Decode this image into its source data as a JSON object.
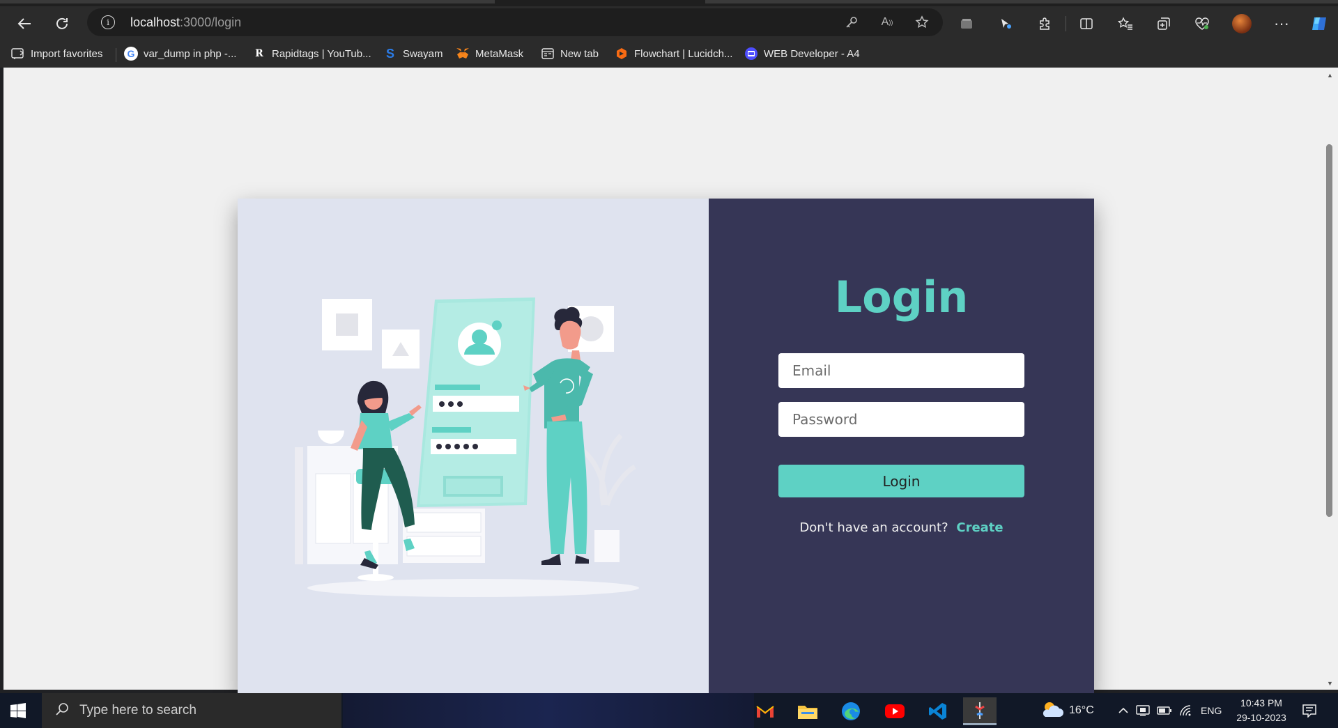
{
  "browser": {
    "url_host": "localhost",
    "url_path": ":3000/login",
    "favorites": [
      {
        "label": "Import favorites"
      },
      {
        "label": "var_dump in php -..."
      },
      {
        "label": "Rapidtags | YouTub..."
      },
      {
        "label": "Swayam"
      },
      {
        "label": "MetaMask"
      },
      {
        "label": "New tab"
      },
      {
        "label": "Flowchart | Lucidch..."
      },
      {
        "label": "WEB Developer - A4"
      }
    ]
  },
  "login": {
    "title": "Login",
    "email_placeholder": "Email",
    "password_placeholder": "Password",
    "button_label": "Login",
    "signup_prompt": "Don't have an account?",
    "signup_link": "Create"
  },
  "colors": {
    "accent": "#5ed1c4",
    "panel": "#363656",
    "illustration_bg": "#dfe3ef"
  },
  "taskbar": {
    "search_placeholder": "Type here to search",
    "temperature": "16°C",
    "language": "ENG",
    "time": "10:43 PM",
    "date": "29-10-2023"
  }
}
